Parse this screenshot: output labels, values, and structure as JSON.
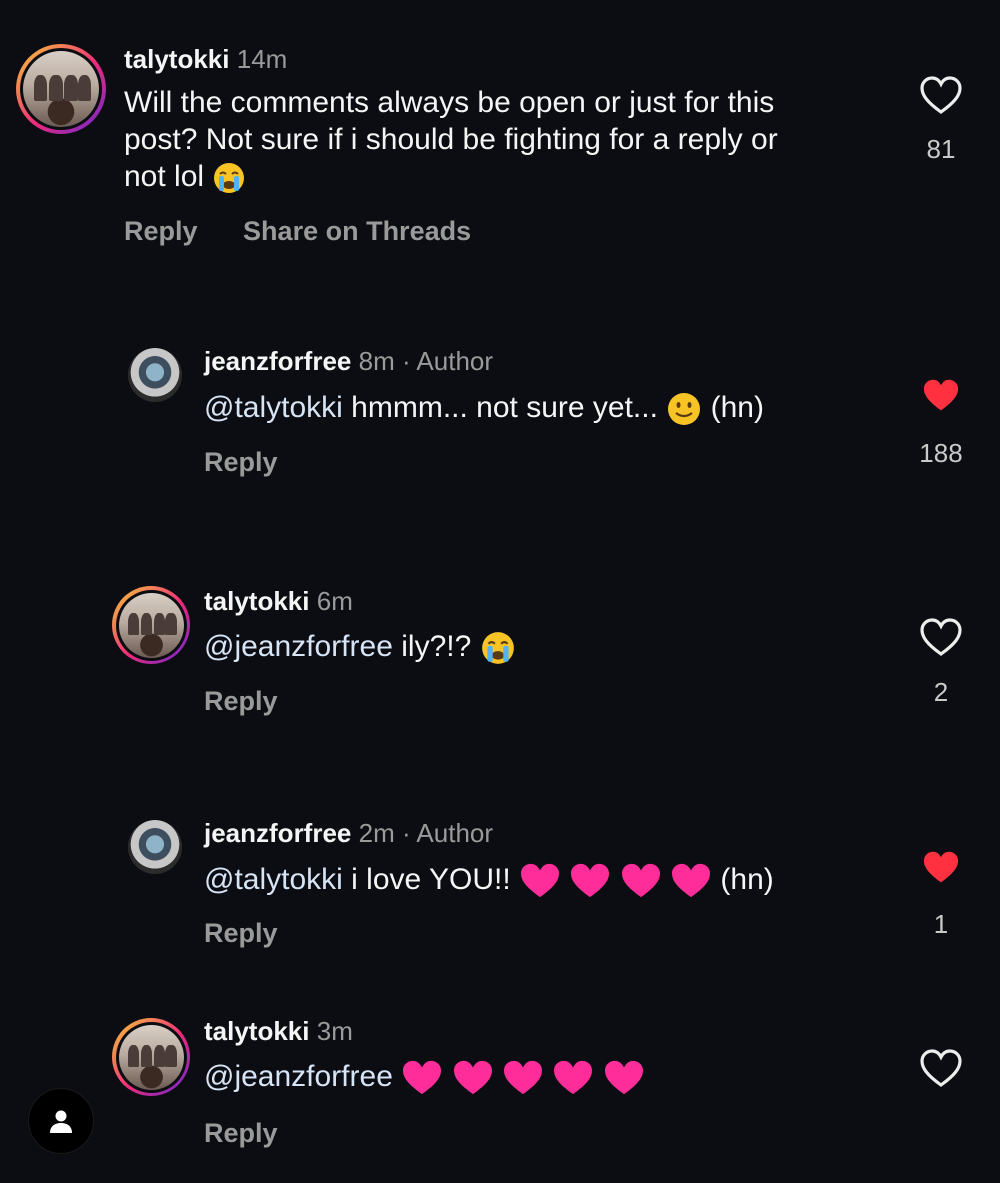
{
  "comments": [
    {
      "user": "talytokki",
      "time": "14m",
      "author_tag": "",
      "text_lines": [
        "Will the comments always be open or just for this",
        "post? Not sure if i should be fighting for a reply or",
        "not lol"
      ],
      "reply_label": "Reply",
      "share_label": "Share on Threads",
      "likes": "81",
      "liked": false
    },
    {
      "user": "jeanzforfree",
      "time": "8m",
      "author_tag": "· Author",
      "mention": "@talytokki",
      "text": "hmmm... not sure yet...",
      "suffix": "(hn)",
      "reply_label": "Reply",
      "likes": "188",
      "liked": true
    },
    {
      "user": "talytokki",
      "time": "6m",
      "author_tag": "",
      "mention": "@jeanzforfree",
      "text": "ily?!?",
      "reply_label": "Reply",
      "likes": "2",
      "liked": false
    },
    {
      "user": "jeanzforfree",
      "time": "2m",
      "author_tag": "· Author",
      "mention": "@talytokki",
      "text": "i love YOU!!",
      "suffix": "(hn)",
      "reply_label": "Reply",
      "likes": "1",
      "liked": true
    },
    {
      "user": "talytokki",
      "time": "3m",
      "author_tag": "",
      "mention": "@jeanzforfree",
      "text": "",
      "reply_label": "Reply",
      "likes": "",
      "liked": false
    }
  ],
  "colors": {
    "heart_liked": "#ff3040",
    "heart_emoji": "#ff2d9a",
    "background": "#0b0d12"
  },
  "icons": {
    "like": "heart-outline-icon",
    "liked": "heart-filled-icon",
    "profile": "person-icon"
  }
}
